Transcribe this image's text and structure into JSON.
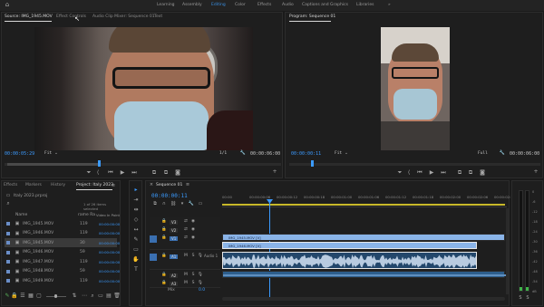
{
  "workspaces": [
    "Learning",
    "Assembly",
    "Editing",
    "Color",
    "Effects",
    "Audio",
    "Captions and Graphics",
    "Libraries"
  ],
  "workspace_active": "Editing",
  "more_glyph": "»",
  "source_monitor": {
    "tabs": [
      "Source: IMG_1945.MOV",
      "Effect Controls",
      "Audio Clip Mixer: Sequence 01",
      "Text"
    ],
    "timecode_in": "00:00:05:29",
    "fit": "Fit",
    "ratio": "1/1",
    "timecode_out": "00:00:06:00"
  },
  "program_monitor": {
    "tabs": [
      "Program: Sequence 01"
    ],
    "timecode_in": "00:00:00:11",
    "fit": "Fit",
    "ratio": "Full",
    "timecode_out": "00:00:06:00"
  },
  "project": {
    "tabs": [
      "Effects",
      "Markers",
      "History",
      "Project: Italy 2023"
    ],
    "file": "Italy 2023.prproj",
    "items_selected": "1 of 26 items selected",
    "col_name": "Name",
    "col_fps": "rame Ra",
    "col_in": "Video In Point",
    "rows": [
      {
        "name": "IMG_1945.MOV",
        "fps": "119",
        "tc": "00:00:00:00",
        "sel": false
      },
      {
        "name": "IMG_1946.MOV",
        "fps": "119",
        "tc": "00:00:00:00",
        "sel": false
      },
      {
        "name": "IMG_1945.MOV",
        "fps": "30",
        "tc": "00:00:00:00",
        "sel": true
      },
      {
        "name": "IMG_1946.MOV",
        "fps": "59",
        "tc": "00:00:00:00",
        "sel": false
      },
      {
        "name": "IMG_1947.MOV",
        "fps": "119",
        "tc": "00:00:00:00",
        "sel": false
      },
      {
        "name": "IMG_1948.MOV",
        "fps": "59",
        "tc": "00:00:00:00",
        "sel": false
      },
      {
        "name": "IMG_1949.MOV",
        "fps": "119",
        "tc": "00:00:00:00",
        "sel": false
      }
    ]
  },
  "timeline": {
    "tab": "Sequence 01",
    "timecode": "00:00:00:11",
    "ruler": [
      "00:00",
      "00:00:00:06",
      "00:00:00:12",
      "00:00:00:18",
      "00:00:01:00",
      "00:00:01:06",
      "00:00:01:12",
      "00:00:01:18",
      "00:00:02:00",
      "00:00:02:06",
      "00:00:02:12"
    ],
    "tracks": [
      "V3",
      "V2",
      "V1",
      "A1",
      "A2",
      "A3"
    ],
    "clip_v2": "IMG_1945.MOV [V]",
    "clip_v1": "IMG_1946.MOV [V]",
    "audio_label": "Audio 1",
    "mix_label": "Mix",
    "mix_value": "0.0"
  },
  "meter_labels": [
    "0",
    "-6",
    "-12",
    "-18",
    "-24",
    "-30",
    "-36",
    "-42",
    "-48",
    "-54",
    "dB"
  ],
  "colors": {
    "accent": "#3b9bff",
    "clip_video": "#8ab4e8",
    "clip_audio": "#3a6e9e"
  }
}
